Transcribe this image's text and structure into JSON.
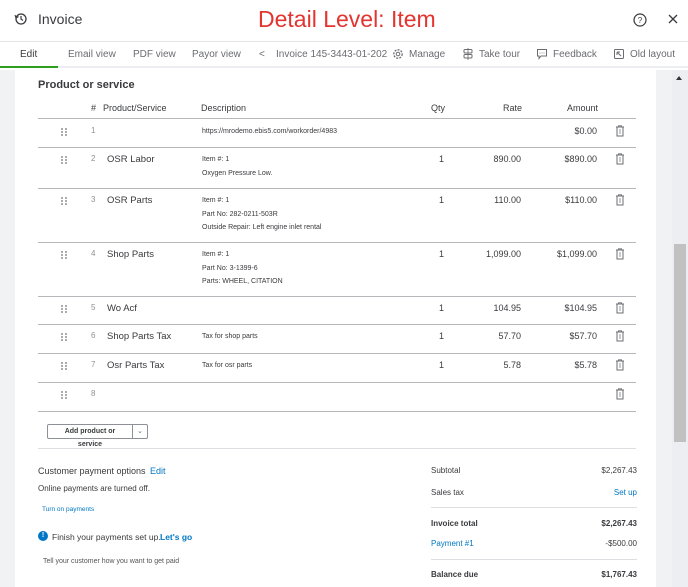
{
  "header": {
    "title": "Invoice",
    "annotation": "Detail Level: Item"
  },
  "tabs": [
    {
      "label": "Edit",
      "active": true
    },
    {
      "label": "Email view",
      "active": false
    },
    {
      "label": "PDF view",
      "active": false
    },
    {
      "label": "Payor view",
      "active": false
    }
  ],
  "invoice_nav": {
    "prev_symbol": "<",
    "label": "Invoice 145-3443-01-202"
  },
  "toolbar": {
    "manage": "Manage",
    "take_tour": "Take tour",
    "feedback": "Feedback",
    "old_layout": "Old layout"
  },
  "products": {
    "section_title": "Product or service",
    "columns": {
      "num": "#",
      "product": "Product/Service",
      "description": "Description",
      "qty": "Qty",
      "rate": "Rate",
      "amount": "Amount"
    },
    "rows": [
      {
        "num": "1",
        "product": "",
        "description": [
          "https://mrodemo.ebis5.com/workorder/4983"
        ],
        "qty": "",
        "rate": "",
        "amount": "$0.00"
      },
      {
        "num": "2",
        "product": "OSR Labor",
        "description": [
          "Item #: 1",
          "Oxygen Pressure Low."
        ],
        "qty": "1",
        "rate": "890.00",
        "amount": "$890.00"
      },
      {
        "num": "3",
        "product": "OSR Parts",
        "description": [
          "Item #: 1",
          "Part No: 282-0211-503R",
          "Outside Repair: Left engine inlet rental"
        ],
        "qty": "1",
        "rate": "110.00",
        "amount": "$110.00"
      },
      {
        "num": "4",
        "product": "Shop Parts",
        "description": [
          "Item #: 1",
          "Part No: 3-1399-6",
          "Parts: WHEEL, CITATION"
        ],
        "qty": "1",
        "rate": "1,099.00",
        "amount": "$1,099.00"
      },
      {
        "num": "5",
        "product": "Wo Acf",
        "description": [],
        "qty": "1",
        "rate": "104.95",
        "amount": "$104.95"
      },
      {
        "num": "6",
        "product": "Shop Parts Tax",
        "description": [
          "Tax for shop parts"
        ],
        "qty": "1",
        "rate": "57.70",
        "amount": "$57.70"
      },
      {
        "num": "7",
        "product": "Osr Parts Tax",
        "description": [
          "Tax for osr parts"
        ],
        "qty": "1",
        "rate": "5.78",
        "amount": "$5.78"
      },
      {
        "num": "8",
        "product": "",
        "description": [],
        "qty": "",
        "rate": "",
        "amount": ""
      }
    ],
    "add_button": "Add product or service"
  },
  "payment_options": {
    "title": "Customer payment options",
    "edit_link": "Edit",
    "status": "Online payments are turned off.",
    "turn_on_link": "Turn on payments",
    "setup_message": "Finish your payments set up.",
    "setup_link": "Let's go",
    "tell_customer": "Tell your customer how you want to get paid"
  },
  "totals": {
    "subtotal_label": "Subtotal",
    "subtotal_value": "$2,267.43",
    "sales_tax_label": "Sales tax",
    "sales_tax_link": "Set up",
    "invoice_total_label": "Invoice total",
    "invoice_total_value": "$2,267.43",
    "payment_label": "Payment #1",
    "payment_value": "-$500.00",
    "balance_due_label": "Balance due",
    "balance_due_value": "$1,767.43"
  }
}
